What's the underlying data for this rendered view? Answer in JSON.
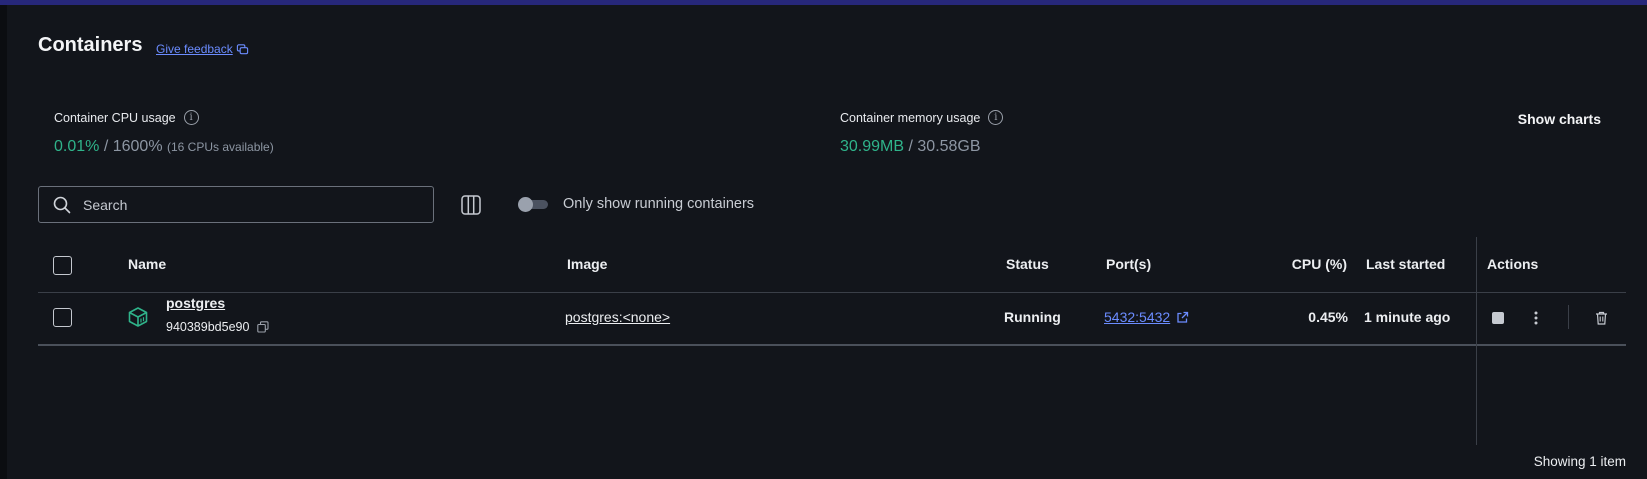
{
  "page": {
    "title": "Containers",
    "feedback_label": "Give feedback"
  },
  "stats": {
    "cpu": {
      "label": "Container CPU usage",
      "used": "0.01%",
      "total": "1600%",
      "note": "(16 CPUs available)"
    },
    "memory": {
      "label": "Container memory usage",
      "used": "30.99MB",
      "total": "30.58GB"
    },
    "show_charts_label": "Show charts"
  },
  "toolbar": {
    "search_placeholder": "Search",
    "running_only_label": "Only show running containers",
    "running_only_on": false
  },
  "table": {
    "headers": {
      "name": "Name",
      "image": "Image",
      "status": "Status",
      "ports": "Port(s)",
      "cpu": "CPU (%)",
      "last_started": "Last started",
      "actions": "Actions"
    },
    "rows": [
      {
        "name": "postgres",
        "id": "940389bd5e90",
        "image": "postgres:<none>",
        "status": "Running",
        "ports": "5432:5432",
        "cpu": "0.45%",
        "last_started": "1 minute ago"
      }
    ]
  },
  "footer": {
    "count_label": "Showing 1 item"
  },
  "colors": {
    "accent_link": "#6b8cff",
    "accent_green": "#2fb38a",
    "top_bar": "#26277a",
    "background": "#12151b"
  },
  "icons": {
    "search": "search-icon",
    "columns": "columns-icon",
    "container": "container-icon",
    "copy": "copy-icon",
    "external_link": "external-link-icon",
    "stop": "stop-icon",
    "more": "more-vertical-icon",
    "delete": "trash-icon",
    "info": "info-icon",
    "feedback": "feedback-icon"
  }
}
